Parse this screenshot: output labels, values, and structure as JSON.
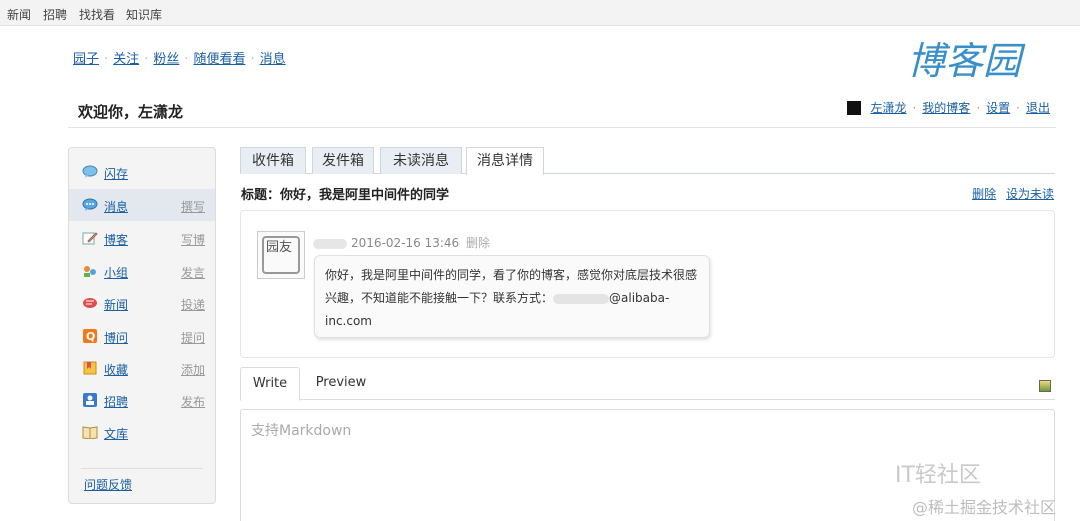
{
  "topbar": {
    "links": [
      "新闻",
      "招聘",
      "找找看",
      "知识库"
    ]
  },
  "main_nav": {
    "items": [
      "园子",
      "关注",
      "粉丝",
      "随便看看",
      "消息"
    ]
  },
  "logo_text": "博客园",
  "welcome": "欢迎你，左潇龙",
  "user_links": {
    "username": "左潇龙",
    "my_blog": "我的博客",
    "settings": "设置",
    "logout": "退出"
  },
  "sidebar": {
    "items": [
      {
        "label": "闪存",
        "action": "",
        "icon": "flash-bubble-icon"
      },
      {
        "label": "消息",
        "action": "撰写",
        "icon": "message-bubble-icon",
        "active": true
      },
      {
        "label": "博客",
        "action": "写博",
        "icon": "blog-pen-icon"
      },
      {
        "label": "小组",
        "action": "发言",
        "icon": "group-icon"
      },
      {
        "label": "新闻",
        "action": "投递",
        "icon": "news-icon"
      },
      {
        "label": "博问",
        "action": "提问",
        "icon": "question-icon"
      },
      {
        "label": "收藏",
        "action": "添加",
        "icon": "bookmark-icon"
      },
      {
        "label": "招聘",
        "action": "发布",
        "icon": "jobs-icon"
      },
      {
        "label": "文库",
        "action": "",
        "icon": "library-book-icon"
      }
    ],
    "feedback": "问题反馈"
  },
  "tabs": [
    "收件箱",
    "发件箱",
    "未读消息",
    "消息详情"
  ],
  "message": {
    "subject": "标题：你好，我是阿里中间件的同学",
    "delete": "删除",
    "mark_unread": "设为未读",
    "timestamp": "2016-02-16 13:46",
    "meta_delete": "删除",
    "avatar_text": "园友",
    "body_line1": "你好，我是阿里中间件的同学，看了你的博客，感觉你对底层技术很感",
    "body_line2_prefix": "兴趣，不知道能不能接触一下？联系方式：",
    "body_line2_suffix": "@alibaba-",
    "body_line3": "inc.com"
  },
  "editor": {
    "write_tab": "Write",
    "preview_tab": "Preview",
    "placeholder": "支持Markdown"
  },
  "watermarks": {
    "line1": "IT轻社区",
    "line2": "@稀土掘金技术社区"
  },
  "colors": {
    "link": "#1a5fa3",
    "tab_bg": "#e9eef4",
    "sidebar_bg": "#f4f4f4",
    "logo": "#3a8fc8"
  }
}
